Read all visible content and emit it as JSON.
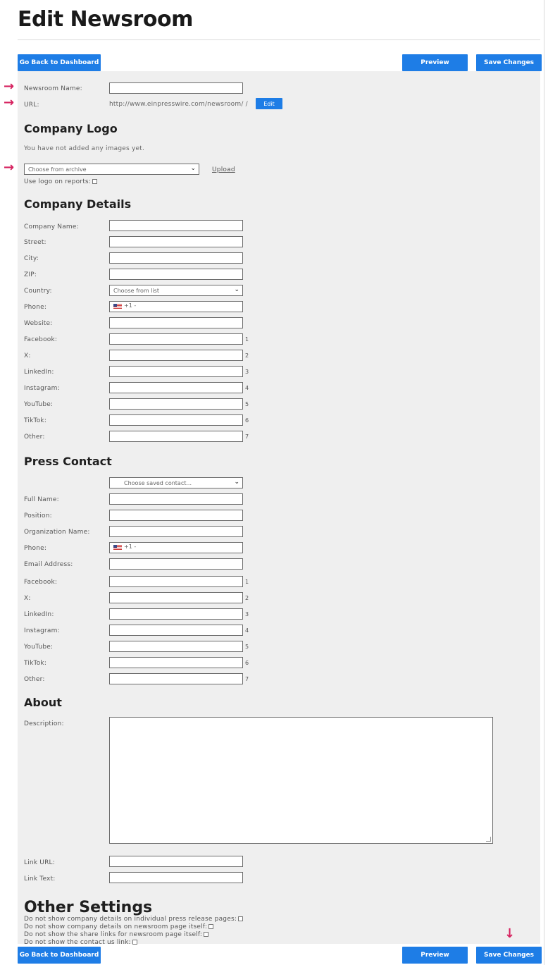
{
  "page": {
    "title": "Edit Newsroom"
  },
  "toolbar": {
    "back_label": "Go Back to Dashboard",
    "preview_label": "Preview",
    "save_label": "Save Changes"
  },
  "general": {
    "newsroom_name_label": "Newsroom Name:",
    "url_label": "URL:",
    "url_value": "http://www.einpresswire.com/newsroom/ /",
    "edit_label": "Edit"
  },
  "logo": {
    "heading": "Company Logo",
    "empty_text": "You have not added any images yet.",
    "archive_select": "Choose from archive",
    "upload_label": "Upload",
    "use_on_reports_label": "Use logo on reports:"
  },
  "company": {
    "heading": "Company Details",
    "company_name": "Company Name:",
    "street": "Street:",
    "city": "City:",
    "zip": "ZIP:",
    "country": "Country:",
    "country_select": "Choose from list",
    "phone": "Phone:",
    "phone_code": "+1 -",
    "website": "Website:",
    "social": [
      {
        "label": "Facebook:",
        "n": "1"
      },
      {
        "label": "X:",
        "n": "2"
      },
      {
        "label": "LinkedIn:",
        "n": "3"
      },
      {
        "label": "Instagram:",
        "n": "4"
      },
      {
        "label": "YouTube:",
        "n": "5"
      },
      {
        "label": "TikTok:",
        "n": "6"
      },
      {
        "label": "Other:",
        "n": "7"
      }
    ]
  },
  "press": {
    "heading": "Press Contact",
    "saved_select": "Choose saved contact...",
    "full_name": "Full Name:",
    "position": "Position:",
    "org_name": "Organization Name:",
    "phone": "Phone:",
    "phone_code": "+1 -",
    "email": "Email Address:",
    "social": [
      {
        "label": "Facebook:",
        "n": "1"
      },
      {
        "label": "X:",
        "n": "2"
      },
      {
        "label": "LinkedIn:",
        "n": "3"
      },
      {
        "label": "Instagram:",
        "n": "4"
      },
      {
        "label": "YouTube:",
        "n": "5"
      },
      {
        "label": "TikTok:",
        "n": "6"
      },
      {
        "label": "Other:",
        "n": "7"
      }
    ]
  },
  "about": {
    "heading": "About",
    "description": "Description:",
    "link_url": "Link URL:",
    "link_text": "Link Text:"
  },
  "other": {
    "heading": "Other Settings",
    "options": [
      "Do not show company details on individual press release pages:",
      "Do not show company details on newsroom page itself:",
      "Do not show the share links for newsroom page itself:",
      "Do not show the contact us link:"
    ]
  },
  "colors": {
    "accent": "#1e7de6",
    "annotation_arrow": "#d6225f",
    "panel": "#efefef"
  }
}
